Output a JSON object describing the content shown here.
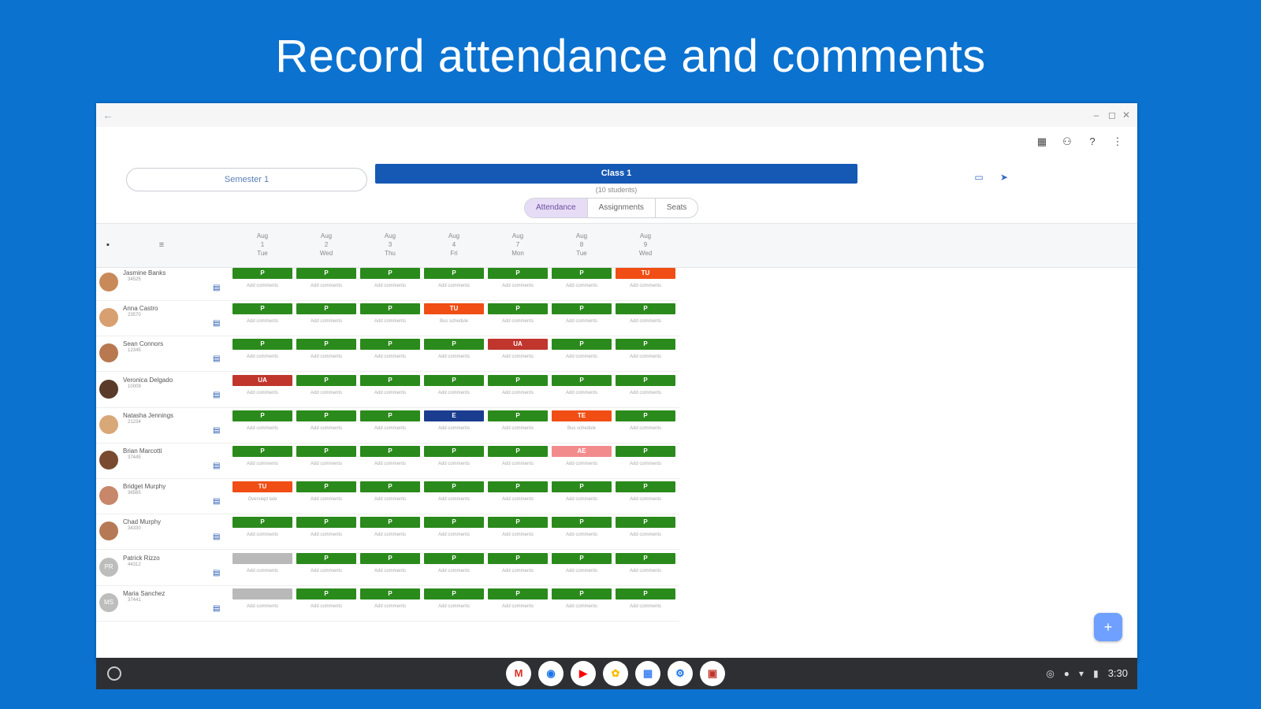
{
  "headline": "Record attendance and comments",
  "window": {
    "back": "←",
    "controls": [
      "–",
      "◻",
      "✕"
    ],
    "toolbar_icons": [
      "qr-code-icon",
      "add-person-icon",
      "help-icon",
      "more-vert-icon"
    ]
  },
  "header": {
    "semester": "Semester 1",
    "class_name": "Class 1",
    "student_count": "(10 students)",
    "icons": [
      "tablet-icon",
      "share-icon"
    ]
  },
  "tabs": [
    {
      "label": "Attendance",
      "active": true
    },
    {
      "label": "Assignments",
      "active": false
    },
    {
      "label": "Seats",
      "active": false
    }
  ],
  "days": [
    {
      "month": "Aug",
      "date": "1",
      "weekday": "Tue"
    },
    {
      "month": "Aug",
      "date": "2",
      "weekday": "Wed"
    },
    {
      "month": "Aug",
      "date": "3",
      "weekday": "Thu"
    },
    {
      "month": "Aug",
      "date": "4",
      "weekday": "Fri"
    },
    {
      "month": "Aug",
      "date": "7",
      "weekday": "Mon"
    },
    {
      "month": "Aug",
      "date": "8",
      "weekday": "Tue"
    },
    {
      "month": "Aug",
      "date": "9",
      "weekday": "Wed"
    }
  ],
  "colors": {
    "P": "#2b8a1c",
    "TU": "#f04e14",
    "TE": "#f04e14",
    "UA": "#c0362c",
    "E": "#1b3d8f",
    "AE": "#f28c8c",
    "none": "#b9b9b9"
  },
  "students": [
    {
      "name": "Jasmine Banks",
      "id": "34525",
      "avatar": "#c98a5a",
      "initials": "",
      "marks": [
        "P",
        "P",
        "P",
        "P",
        "P",
        "P",
        "TU"
      ],
      "notes": [
        "Add comments",
        "Add comments",
        "Add comments",
        "Add comments",
        "Add comments",
        "Add comments",
        "Add comments"
      ]
    },
    {
      "name": "Anna Castro",
      "id": "23570",
      "avatar": "#d8a070",
      "initials": "",
      "marks": [
        "P",
        "P",
        "P",
        "TU",
        "P",
        "P",
        "P"
      ],
      "notes": [
        "Add comments",
        "Add comments",
        "Add comments",
        "Bus schedule",
        "Add comments",
        "Add comments",
        "Add comments"
      ]
    },
    {
      "name": "Sean Connors",
      "id": "12345",
      "avatar": "#b87850",
      "initials": "",
      "marks": [
        "P",
        "P",
        "P",
        "P",
        "UA",
        "P",
        "P"
      ],
      "notes": [
        "Add comments",
        "Add comments",
        "Add comments",
        "Add comments",
        "Add comments",
        "Add comments",
        "Add comments"
      ]
    },
    {
      "name": "Veronica Delgado",
      "id": "10009",
      "avatar": "#5a3a28",
      "initials": "",
      "marks": [
        "UA",
        "P",
        "P",
        "P",
        "P",
        "P",
        "P"
      ],
      "notes": [
        "Add comments",
        "Add comments",
        "Add comments",
        "Add comments",
        "Add comments",
        "Add comments",
        "Add comments"
      ]
    },
    {
      "name": "Natasha Jennings",
      "id": "21234",
      "avatar": "#d9a878",
      "initials": "",
      "marks": [
        "P",
        "P",
        "P",
        "E",
        "P",
        "TE",
        "P"
      ],
      "notes": [
        "Add comments",
        "Add comments",
        "Add comments",
        "Add comments",
        "Add comments",
        "Bus schedule",
        "Add comments"
      ]
    },
    {
      "name": "Brian Marcotti",
      "id": "37445",
      "avatar": "#7a4a30",
      "initials": "",
      "marks": [
        "P",
        "P",
        "P",
        "P",
        "P",
        "AE",
        "P"
      ],
      "notes": [
        "Add comments",
        "Add comments",
        "Add comments",
        "Add comments",
        "Add comments",
        "Add comments",
        "Add comments"
      ]
    },
    {
      "name": "Bridget Murphy",
      "id": "36565",
      "avatar": "#c8866a",
      "initials": "",
      "marks": [
        "TU",
        "P",
        "P",
        "P",
        "P",
        "P",
        "P"
      ],
      "notes": [
        "Overslept late",
        "Add comments",
        "Add comments",
        "Add comments",
        "Add comments",
        "Add comments",
        "Add comments"
      ]
    },
    {
      "name": "Chad Murphy",
      "id": "34330",
      "avatar": "#b57a55",
      "initials": "",
      "marks": [
        "P",
        "P",
        "P",
        "P",
        "P",
        "P",
        "P"
      ],
      "notes": [
        "Add comments",
        "Add comments",
        "Add comments",
        "Add comments",
        "Add comments",
        "Add comments",
        "Add comments"
      ]
    },
    {
      "name": "Patrick Rizzo",
      "id": "44312",
      "avatar": "#bdbdbd",
      "initials": "PR",
      "marks": [
        "none",
        "P",
        "P",
        "P",
        "P",
        "P",
        "P"
      ],
      "notes": [
        "Add comments",
        "Add comments",
        "Add comments",
        "Add comments",
        "Add comments",
        "Add comments",
        "Add comments"
      ]
    },
    {
      "name": "Maria Sanchez",
      "id": "37441",
      "avatar": "#bdbdbd",
      "initials": "MS",
      "marks": [
        "none",
        "P",
        "P",
        "P",
        "P",
        "P",
        "P"
      ],
      "notes": [
        "Add comments",
        "Add comments",
        "Add comments",
        "Add comments",
        "Add comments",
        "Add comments",
        "Add comments"
      ]
    }
  ],
  "fab": "+",
  "shelf": {
    "apps": [
      {
        "name": "gmail-icon",
        "glyph": "M",
        "color": "#d93025"
      },
      {
        "name": "chrome-icon",
        "glyph": "◉",
        "color": "#1a73e8"
      },
      {
        "name": "youtube-icon",
        "glyph": "▶",
        "color": "#ff0000"
      },
      {
        "name": "photos-icon",
        "glyph": "✿",
        "color": "#fbbc04"
      },
      {
        "name": "calculator-icon",
        "glyph": "▦",
        "color": "#4285f4"
      },
      {
        "name": "settings-icon",
        "glyph": "⚙",
        "color": "#1a73e8"
      },
      {
        "name": "attendance-app-icon",
        "glyph": "▣",
        "color": "#c0362c"
      }
    ],
    "time": "3:30"
  }
}
